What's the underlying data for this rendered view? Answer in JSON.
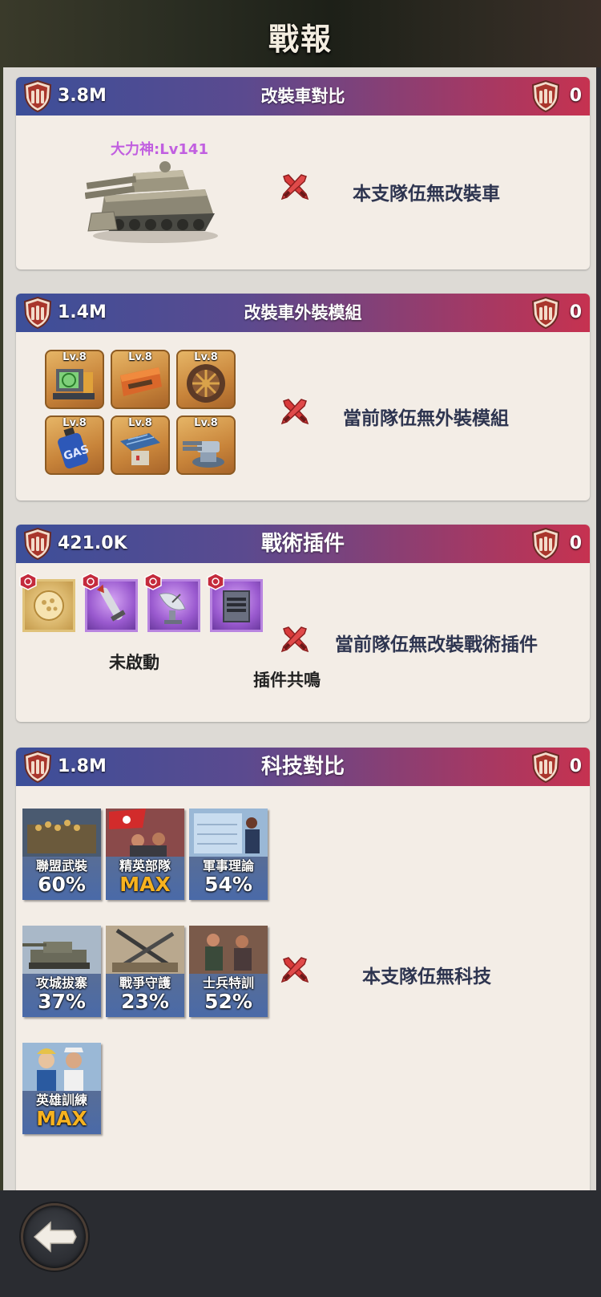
{
  "header": {
    "title": "戰報"
  },
  "sections": {
    "vehicle": {
      "title": "改裝車對比",
      "left_power": "3.8M",
      "right_power": "0",
      "vehicle_label": "大力神:Lv141",
      "empty_text": "本支隊伍無改裝車"
    },
    "skins": {
      "title": "改裝車外裝模組",
      "left_power": "1.4M",
      "right_power": "0",
      "modules": [
        "Lv.8",
        "Lv.8",
        "Lv.8",
        "Lv.8",
        "Lv.8",
        "Lv.8"
      ],
      "empty_text": "當前隊伍無外裝模組"
    },
    "plugins": {
      "title": "戰術插件",
      "left_power": "421.0K",
      "right_power": "0",
      "status_text": "未啟動",
      "resonance_text": "插件共鳴",
      "empty_text": "當前隊伍無改裝戰術插件"
    },
    "tech": {
      "title": "科技對比",
      "left_power": "1.8M",
      "right_power": "0",
      "items": [
        {
          "name": "聯盟武裝",
          "value": "60%"
        },
        {
          "name": "精英部隊",
          "value": "MAX"
        },
        {
          "name": "軍事理論",
          "value": "54%"
        },
        {
          "name": "攻城拔寨",
          "value": "37%"
        },
        {
          "name": "戰爭守護",
          "value": "23%"
        },
        {
          "name": "士兵特訓",
          "value": "52%"
        },
        {
          "name": "英雄訓練",
          "value": "MAX"
        }
      ],
      "empty_text": "本支隊伍無科技"
    }
  },
  "colors": {
    "accent_max": "#f7b21f",
    "header_left": "#3c4f99",
    "header_right": "#c63250"
  },
  "icons": {
    "power": "shield-bullets-icon",
    "vs": "crossed-swords-icon",
    "back": "back-arrow-icon"
  }
}
